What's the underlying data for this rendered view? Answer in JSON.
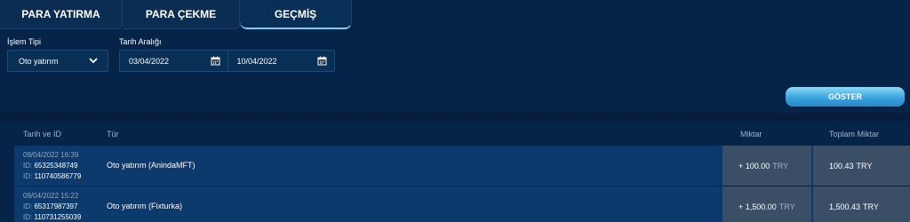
{
  "tabs": [
    {
      "label": "PARA YATIRMA"
    },
    {
      "label": "PARA ÇEKME"
    },
    {
      "label": "GEÇMİŞ",
      "active": true
    }
  ],
  "filters": {
    "type_label": "İşlem Tipi",
    "type_value": "Oto yatırım",
    "date_label": "Tarih Aralığı",
    "date_from": "03/04/2022",
    "date_to": "10/04/2022",
    "show_button": "GÖSTER"
  },
  "table": {
    "headers": {
      "date_id": "Tarih ve ID",
      "type": "Tür",
      "amount": "Miktar",
      "total": "Toplam Miktar"
    },
    "rows": [
      {
        "datetime": "09/04/2022 16:39",
        "id_prefix": "ID:",
        "id1": "65325348749",
        "id2": "110740586779",
        "type": "Oto yatırım (AnindaMFT)",
        "amount": "+ 100.00",
        "amount_currency": "TRY",
        "total": "100.43",
        "total_currency": "TRY"
      },
      {
        "datetime": "09/04/2022 15:22",
        "id_prefix": "ID:",
        "id1": "65317987397",
        "id2": "110731255039",
        "type": "Oto yatırım (Fixturka)",
        "amount": "+ 1,500.00",
        "amount_currency": "TRY",
        "total": "1,500.43",
        "total_currency": "TRY"
      }
    ]
  },
  "icons": {
    "dropdown": "chevron-down-icon",
    "calendar": "calendar-icon"
  },
  "colors": {
    "background": "#062447",
    "accent": "#38a3de",
    "row": "#0d3a6c",
    "amount_cell": "#3a4f66"
  }
}
